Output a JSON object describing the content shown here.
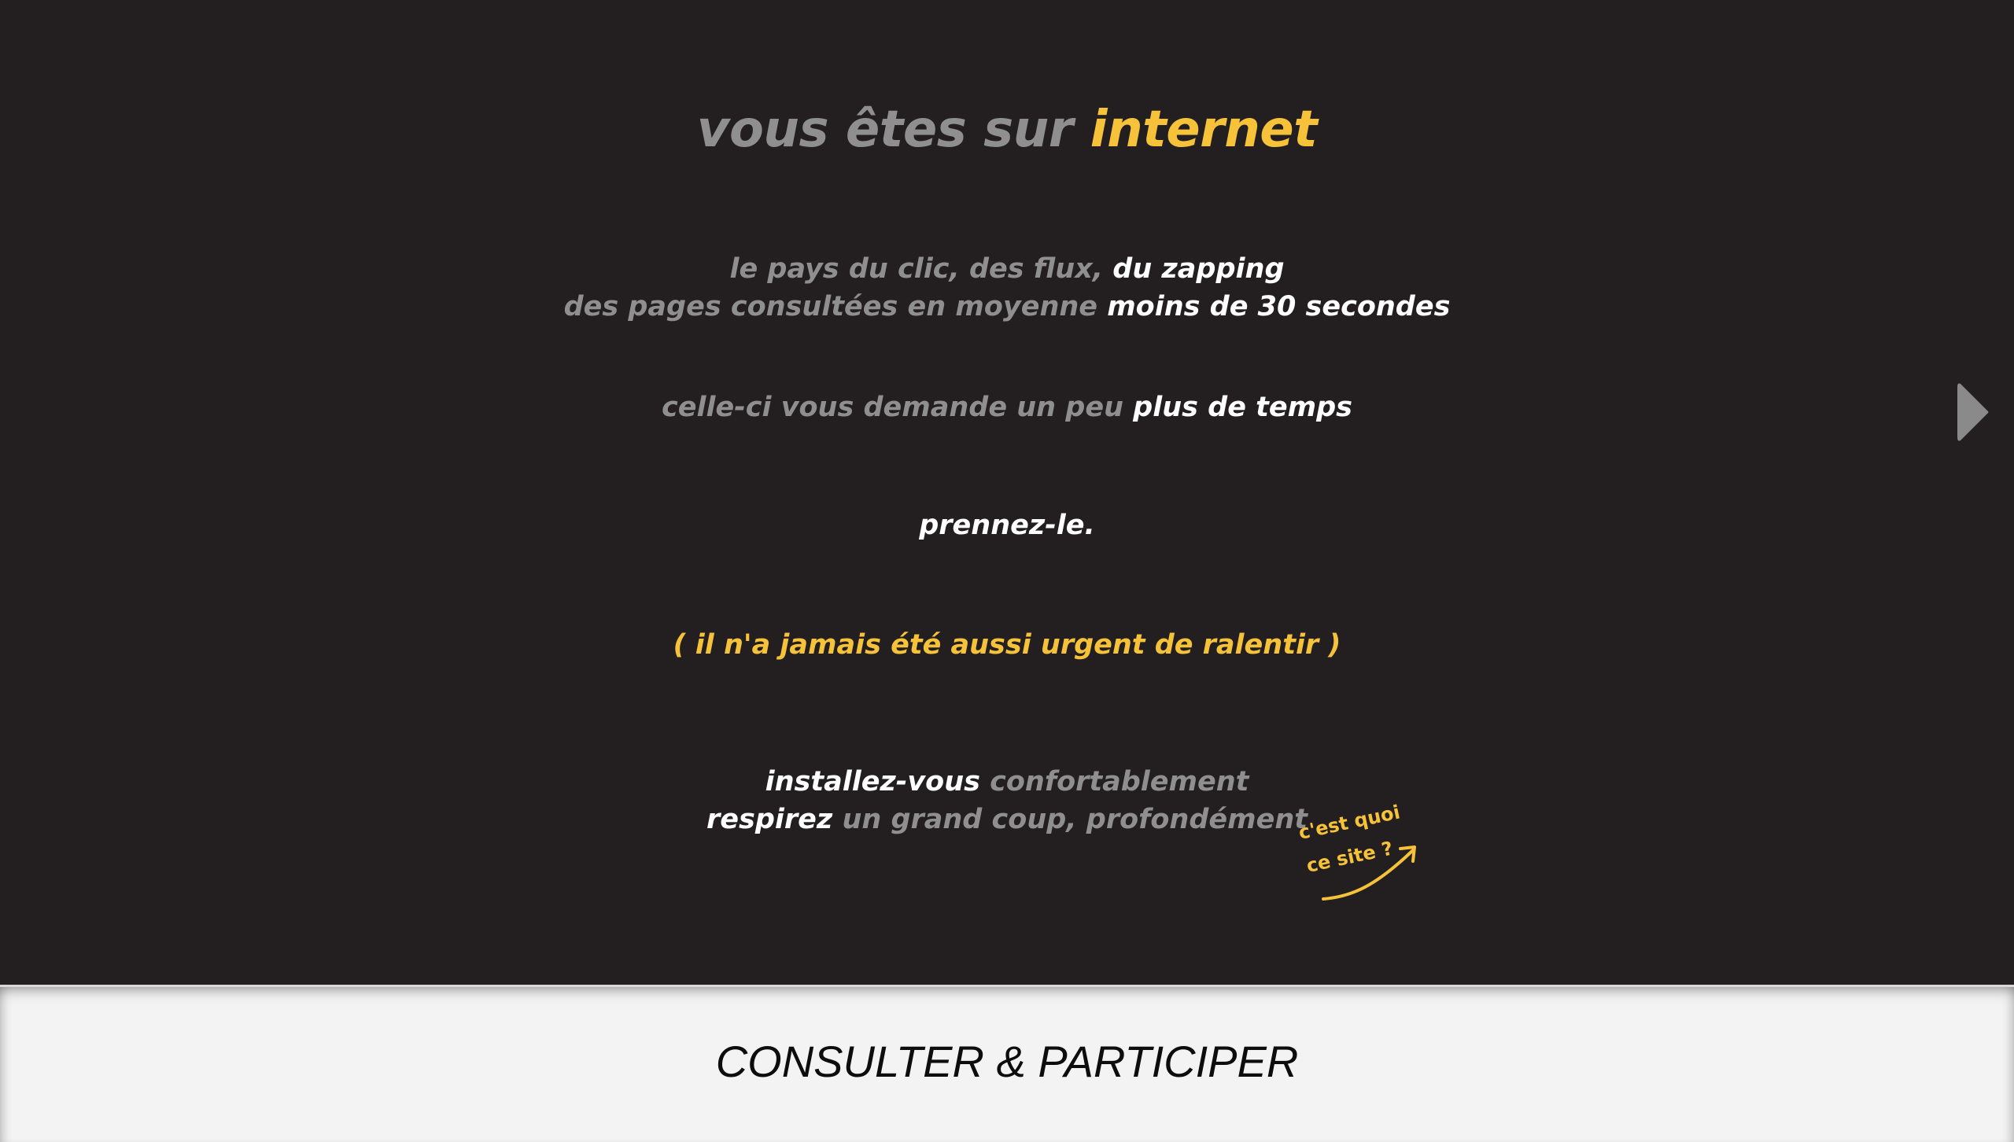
{
  "headline": {
    "part1": "vous êtes sur ",
    "part2": "internet"
  },
  "lines": {
    "l1_grey": "le pays du clic, des flux, ",
    "l1_white": "du zapping",
    "l2_grey": "des pages consultées en moyenne ",
    "l2_white": "moins de 30 secondes",
    "l3_grey": "celle-ci vous demande un peu ",
    "l3_white": "plus de temps",
    "l4_white": "prennez-le.",
    "l5_yellow": "( il n'a jamais été aussi urgent de ralentir )",
    "l6_white": "installez-vous ",
    "l6_grey": "confortablement",
    "l7_white": "respirez ",
    "l7_grey": "un grand coup, profondément"
  },
  "note": {
    "line1": "c'est quoi",
    "line2": "ce site ?"
  },
  "footer": {
    "button_label": "CONSULTER & PARTICIPER"
  },
  "icons": {
    "next": "chevron-right-icon",
    "note_arrow": "curved-arrow-icon"
  },
  "colors": {
    "background": "#231f20",
    "accent": "#f6c23a",
    "muted": "#8f8f8f",
    "footer": "#f3f3f3"
  }
}
